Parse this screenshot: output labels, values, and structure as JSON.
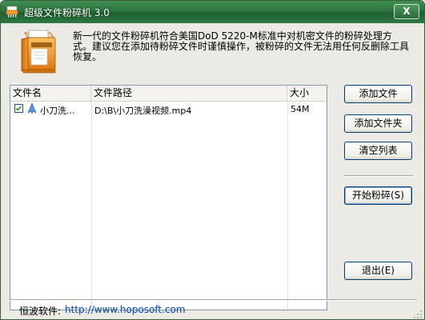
{
  "window": {
    "title": "超级文件粉碎机  3.0",
    "close_label": "X"
  },
  "description": "新一代的文件粉碎机符合美国DoD 5220-M标准中对机密文件的粉碎处理方式。建议您在添加待粉碎文件时谨慎操作，被粉碎的文件无法用任何反删除工具恢复。",
  "file_list": {
    "columns": [
      "文件名",
      "文件路径",
      "大小"
    ],
    "rows": [
      {
        "checked": true,
        "name": "小刀洗...",
        "path": "D:\\B\\小刀洗澡视频.mp4",
        "size": "54M"
      }
    ]
  },
  "buttons": {
    "add_file": "添加文件",
    "add_folder": "添加文件夹",
    "clear_list": "清空列表",
    "start_shred": "开始粉碎(S)",
    "exit": "退出(E)"
  },
  "footer": {
    "label": "恒波软件:",
    "link": "http://www.hoposoft.com"
  },
  "colors": {
    "titlebar": "#2d7340",
    "link": "#0044aa",
    "list_border": "#7f9db9"
  }
}
